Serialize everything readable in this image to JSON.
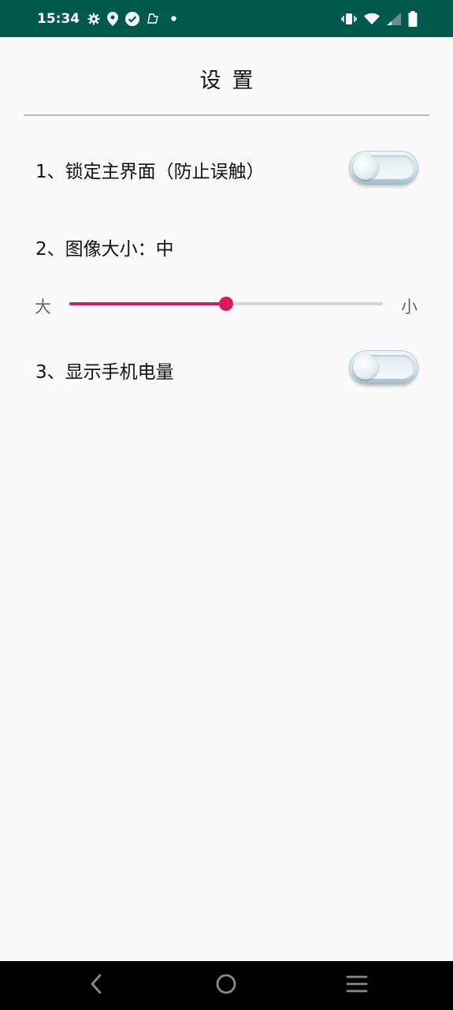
{
  "status_bar": {
    "time": "15:34",
    "left_icons": [
      "gear-icon",
      "location-pin-icon",
      "check-circle-icon",
      "app-notification-icon",
      "dot-icon"
    ],
    "right_icons": [
      "vibrate-icon",
      "wifi-icon",
      "cell-signal-icon",
      "battery-icon"
    ],
    "background": "#00594d"
  },
  "header": {
    "title": "设置"
  },
  "settings": {
    "lock": {
      "label": "1、锁定主界面（防止误触）",
      "enabled": false
    },
    "image_size": {
      "label": "2、图像大小：中",
      "min_label": "大",
      "max_label": "小",
      "value": 0.5,
      "accent_color": "#d81b60"
    },
    "battery": {
      "label": "3、显示手机电量",
      "enabled": false
    }
  },
  "nav_bar": {
    "buttons": [
      "back-icon",
      "home-icon",
      "menu-icon"
    ]
  }
}
